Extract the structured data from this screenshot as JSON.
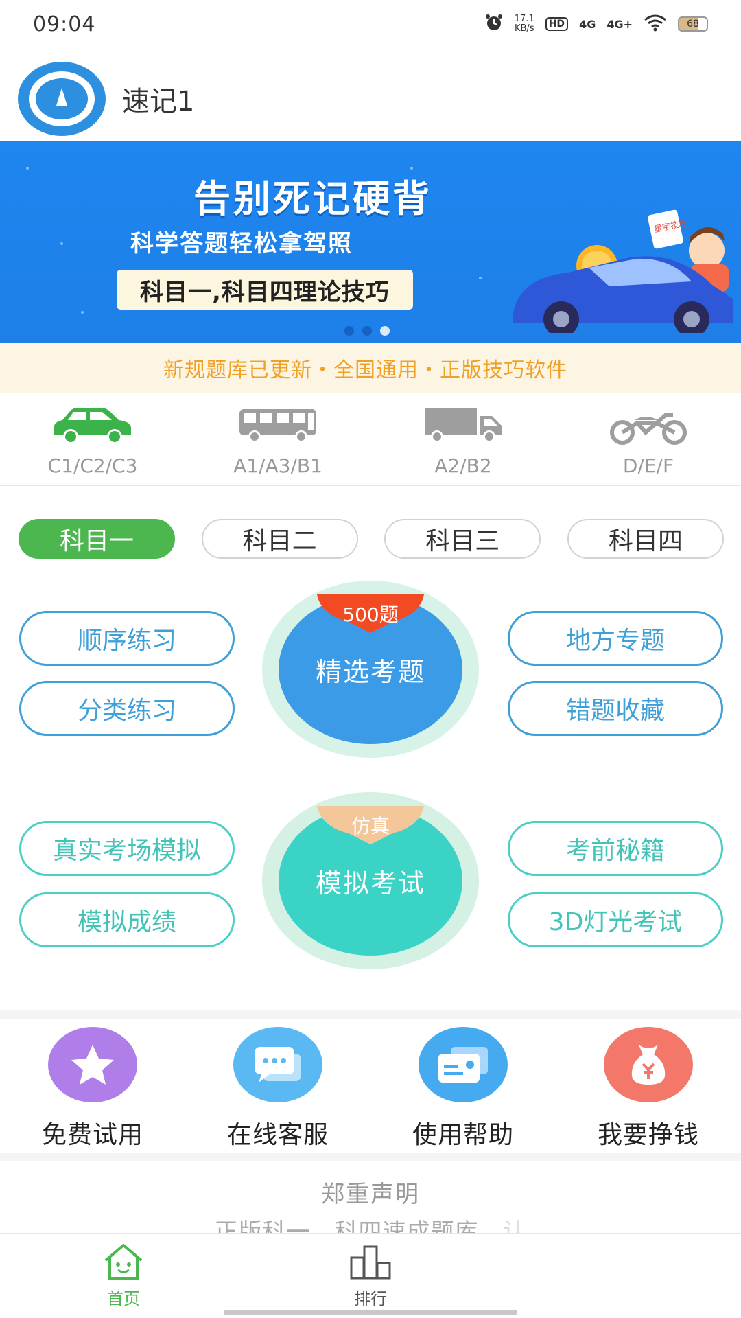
{
  "status_bar": {
    "time": "09:04",
    "speed_value": "17.1",
    "speed_unit": "KB/s",
    "hd_label": "HD",
    "signal_1": "4G",
    "signal_2": "4G+",
    "battery": "68",
    "icons": [
      "alarm-icon",
      "wifi-icon",
      "battery-icon"
    ]
  },
  "header": {
    "title": "速记1"
  },
  "banner": {
    "headline": "告别死记硬背",
    "subheadline": "科学答题轻松拿驾照",
    "pill": "科目一,科目四理论技巧",
    "sign_text": "星宇技巧",
    "slide_count": 3,
    "active_slide": 3
  },
  "notice": {
    "text": "新规题库已更新・全国通用・正版技巧软件"
  },
  "licenses": [
    {
      "label": "C1/C2/C3",
      "icon": "car-icon",
      "color": "#3cb34a",
      "selected": true
    },
    {
      "label": "A1/A3/B1",
      "icon": "bus-icon",
      "color": "#9e9e9e",
      "selected": false
    },
    {
      "label": "A2/B2",
      "icon": "truck-icon",
      "color": "#9e9e9e",
      "selected": false
    },
    {
      "label": "D/E/F",
      "icon": "motorcycle-icon",
      "color": "#9e9e9e",
      "selected": false
    }
  ],
  "subjects": [
    {
      "label": "科目一",
      "active": true
    },
    {
      "label": "科目二",
      "active": false
    },
    {
      "label": "科目三",
      "active": false
    },
    {
      "label": "科目四",
      "active": false
    }
  ],
  "practice": {
    "sequential": "顺序练习",
    "category": "分类练习",
    "regional": "地方专题",
    "mistakes": "错题收藏",
    "featured_badge": "500题",
    "featured_label": "精选考题"
  },
  "exam": {
    "real_sim": "真实考场模拟",
    "scores": "模拟成绩",
    "tips": "考前秘籍",
    "lights_3d": "3D灯光考试",
    "badge": "仿真",
    "label": "模拟考试"
  },
  "tools": [
    {
      "label": "免费试用",
      "icon": "star-icon",
      "color": "#b07ee8"
    },
    {
      "label": "在线客服",
      "icon": "chat-icon",
      "color": "#5ab8f2"
    },
    {
      "label": "使用帮助",
      "icon": "card-icon",
      "color": "#46aaf0"
    },
    {
      "label": "我要挣钱",
      "icon": "money-bag-icon",
      "color": "#f4786a"
    }
  ],
  "declaration": {
    "title": "郑重声明",
    "text": "正版科一、科四速成题库，认"
  },
  "bottom_nav": [
    {
      "label": "首页",
      "icon": "home-icon",
      "active": true
    },
    {
      "label": "排行",
      "icon": "ranking-icon",
      "active": false
    }
  ],
  "colors": {
    "brand_green": "#4cb74f",
    "practice_blue": "#3ea0d6",
    "exam_teal": "#44c4b6",
    "notice_orange": "#f0a125",
    "banner_blue": "#1f86ef"
  }
}
